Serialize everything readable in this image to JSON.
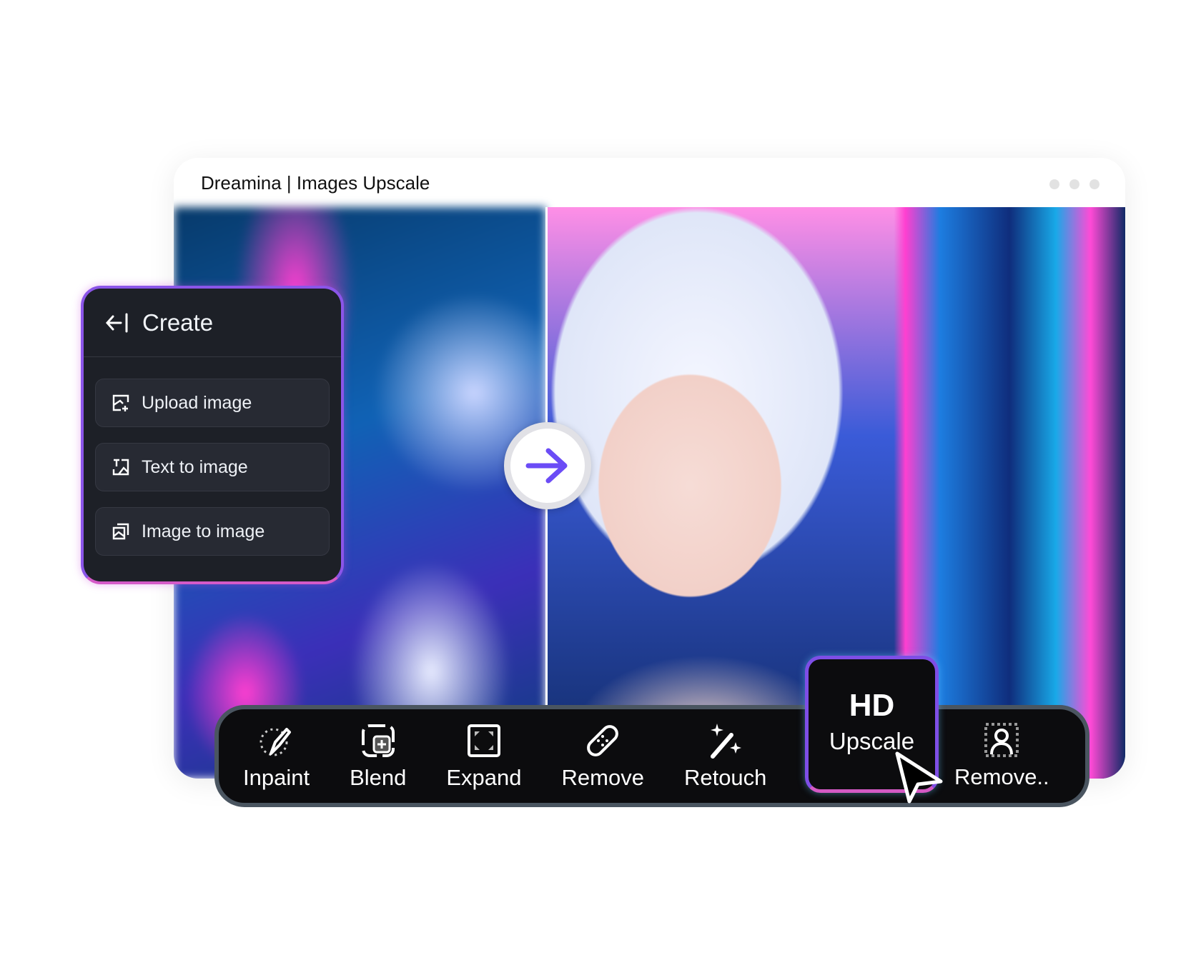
{
  "window": {
    "title": "Dreamina | Images Upscale"
  },
  "panel": {
    "title": "Create",
    "items": [
      {
        "label": "Upload image",
        "icon": "upload-image-icon"
      },
      {
        "label": "Text to image",
        "icon": "text-to-image-icon"
      },
      {
        "label": "Image to image",
        "icon": "image-to-image-icon"
      }
    ]
  },
  "toolbar": {
    "tools": [
      {
        "label": "Inpaint",
        "icon": "brush-icon"
      },
      {
        "label": "Blend",
        "icon": "blend-icon"
      },
      {
        "label": "Expand",
        "icon": "expand-icon"
      },
      {
        "label": "Remove",
        "icon": "bandage-icon"
      },
      {
        "label": "Retouch",
        "icon": "magic-wand-icon"
      }
    ],
    "hd": {
      "top": "HD",
      "bottom": "Upscale"
    },
    "remove_bg": {
      "label": "Remove..",
      "icon": "person-cutout-icon"
    }
  },
  "colors": {
    "accent": "#7e4ee6",
    "accent2": "#d459c4",
    "arrow": "#6b4cf6"
  }
}
